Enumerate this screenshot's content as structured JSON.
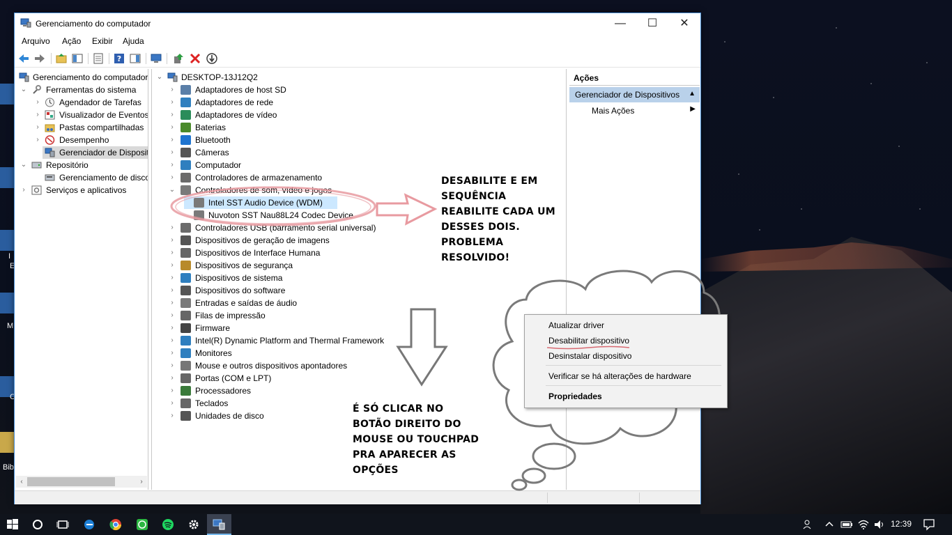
{
  "window": {
    "title": "Gerenciamento do computador",
    "controls": {
      "minimize": "—",
      "maximize": "☐",
      "close": "✕"
    }
  },
  "menu": [
    "Arquivo",
    "Ação",
    "Exibir",
    "Ajuda"
  ],
  "left_tree": {
    "items": [
      {
        "label": "Gerenciamento do computador",
        "icon": "computer-management-icon"
      },
      {
        "label": "Ferramentas do sistema",
        "icon": "tools-icon"
      },
      {
        "label": "Agendador de Tarefas",
        "icon": "clock-icon"
      },
      {
        "label": "Visualizador de Eventos",
        "icon": "event-viewer-icon"
      },
      {
        "label": "Pastas compartilhadas",
        "icon": "shared-folder-icon"
      },
      {
        "label": "Desempenho",
        "icon": "performance-icon"
      },
      {
        "label": "Gerenciador de Dispositivos",
        "icon": "device-manager-icon"
      },
      {
        "label": "Repositório",
        "icon": "storage-icon"
      },
      {
        "label": "Gerenciamento de disco",
        "icon": "disk-icon"
      },
      {
        "label": "Serviços e aplicativos",
        "icon": "services-icon"
      }
    ]
  },
  "device_tree": {
    "root": "DESKTOP-13J12Q2",
    "categories": [
      {
        "label": "Adaptadores de host SD",
        "icon": "sd-host-icon",
        "color": "#5a7fa8"
      },
      {
        "label": "Adaptadores de rede",
        "icon": "network-adapter-icon",
        "color": "#2f7fbf"
      },
      {
        "label": "Adaptadores de vídeo",
        "icon": "display-adapter-icon",
        "color": "#2a8c5a"
      },
      {
        "label": "Baterias",
        "icon": "battery-icon",
        "color": "#4a8a2a"
      },
      {
        "label": "Bluetooth",
        "icon": "bluetooth-icon",
        "color": "#1e74d0"
      },
      {
        "label": "Câmeras",
        "icon": "camera-icon",
        "color": "#555555"
      },
      {
        "label": "Computador",
        "icon": "computer-icon",
        "color": "#2f7fbf"
      },
      {
        "label": "Controladores de armazenamento",
        "icon": "storage-controller-icon",
        "color": "#6b6b6b"
      },
      {
        "label": "Controladores de som, vídeo e jogos",
        "icon": "speaker-icon",
        "color": "#7a7a7a"
      },
      {
        "label": "Intel SST Audio Device (WDM)",
        "icon": "speaker-icon",
        "color": "#7a7a7a"
      },
      {
        "label": "Nuvoton SST Nau88L24 Codec Device",
        "icon": "speaker-icon",
        "color": "#7a7a7a"
      },
      {
        "label": "Controladores USB (barramento serial universal)",
        "icon": "usb-icon",
        "color": "#6b6b6b"
      },
      {
        "label": "Dispositivos de geração de imagens",
        "icon": "imaging-icon",
        "color": "#555555"
      },
      {
        "label": "Dispositivos de Interface Humana",
        "icon": "hid-icon",
        "color": "#666666"
      },
      {
        "label": "Dispositivos de segurança",
        "icon": "security-key-icon",
        "color": "#b88a2a"
      },
      {
        "label": "Dispositivos de sistema",
        "icon": "system-device-icon",
        "color": "#2f7fbf"
      },
      {
        "label": "Dispositivos do software",
        "icon": "software-device-icon",
        "color": "#555555"
      },
      {
        "label": "Entradas e saídas de áudio",
        "icon": "speaker-icon",
        "color": "#7a7a7a"
      },
      {
        "label": "Filas de impressão",
        "icon": "printer-icon",
        "color": "#666666"
      },
      {
        "label": "Firmware",
        "icon": "firmware-icon",
        "color": "#444444"
      },
      {
        "label": "Intel(R) Dynamic Platform and Thermal Framework",
        "icon": "thermal-icon",
        "color": "#2f7fbf"
      },
      {
        "label": "Monitores",
        "icon": "monitor-icon",
        "color": "#2f7fbf"
      },
      {
        "label": "Mouse e outros dispositivos apontadores",
        "icon": "mouse-icon",
        "color": "#777777"
      },
      {
        "label": "Portas (COM e LPT)",
        "icon": "port-icon",
        "color": "#666666"
      },
      {
        "label": "Processadores",
        "icon": "processor-icon",
        "color": "#3a7a3a"
      },
      {
        "label": "Teclados",
        "icon": "keyboard-icon",
        "color": "#666666"
      },
      {
        "label": "Unidades de disco",
        "icon": "disk-drive-icon",
        "color": "#555555"
      }
    ]
  },
  "actions": {
    "title": "Ações",
    "group": "Gerenciador de Dispositivos",
    "more": "Mais Ações"
  },
  "context_menu": {
    "items": [
      "Atualizar driver",
      "Desabilitar dispositivo",
      "Desinstalar dispositivo",
      "Verificar se há alterações de hardware",
      "Propriedades"
    ]
  },
  "annotations": {
    "instruction_lines": [
      "DESABILITE E EM",
      "SEQUÊNCIA",
      "REABILITE CADA UM",
      "DESSES DOIS.",
      "PROBLEMA",
      "RESOLVIDO!"
    ],
    "tip_lines": [
      "É SÓ CLICAR  NO",
      "BOTÃO DIREITO DO",
      "MOUSE OU TOUCHPAD",
      "PRA APARECER AS",
      "OPÇÕES"
    ]
  },
  "desktop_icons": [
    "I",
    "E",
    "M",
    "C",
    "Bib"
  ],
  "taskbar": {
    "time": "12:39",
    "apps": [
      "start-icon",
      "cortana-icon",
      "task-view-icon",
      "edge-icon",
      "chrome-icon",
      "whatsapp-icon",
      "spotify-icon",
      "settings-icon",
      "computer-management-icon"
    ]
  },
  "colors": {
    "accent": "#0078d7",
    "selection": "#cce8ff",
    "annotation_pink": "#e89aa0",
    "actions_header": "#b9d1ea"
  }
}
